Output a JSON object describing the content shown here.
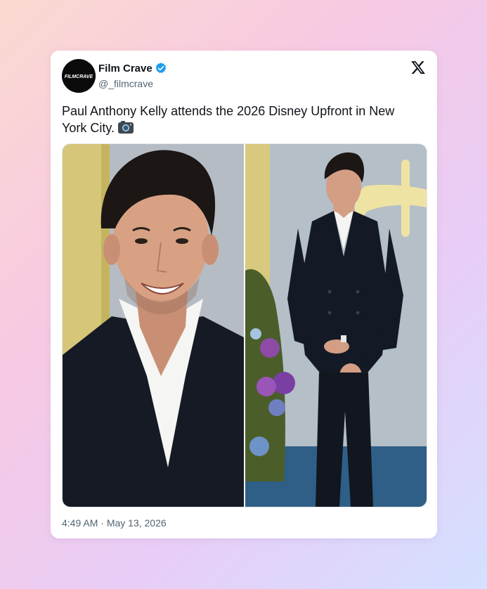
{
  "post": {
    "author_name": "Film Crave",
    "author_handle": "@_filmcrave",
    "avatar_logo_text": "FILMCRAVE",
    "verified": true,
    "text": "Paul Anthony Kelly attends the 2026 Disney Upfront in New York City.",
    "text_emoji_icon": "camera-icon",
    "time": "4:49 AM",
    "separator": "·",
    "date": "May 13, 2026",
    "platform_icon": "x-logo-icon",
    "verified_color": "#1d9bf0"
  },
  "media": [
    {
      "kind": "photo",
      "subject": "close-up portrait",
      "icon": "photo-portrait"
    },
    {
      "kind": "photo",
      "subject": "full-length portrait",
      "icon": "photo-full-length"
    }
  ]
}
